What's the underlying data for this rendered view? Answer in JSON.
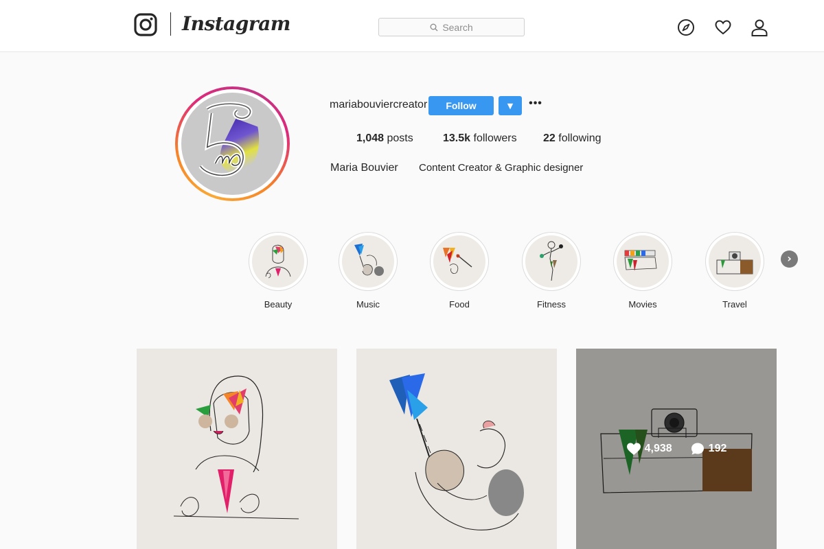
{
  "header": {
    "wordmark": "Instagram",
    "search": {
      "placeholder": "Search"
    },
    "icons": [
      "instagram-logo-icon",
      "compass-icon",
      "heart-icon",
      "person-icon"
    ]
  },
  "profile": {
    "username": "mariabouviercreator",
    "follow_label": "Follow",
    "dropdown_label": "▼",
    "more_label": "•••",
    "stats": [
      {
        "count": "1,048",
        "label": "posts"
      },
      {
        "count": "13.5k",
        "label": "followers"
      },
      {
        "count": "22",
        "label": "following"
      }
    ],
    "full_name": "Maria Bouvier",
    "bio": "Content Creator & Graphic designer"
  },
  "highlights": [
    {
      "label": "Beauty"
    },
    {
      "label": "Music"
    },
    {
      "label": "Food"
    },
    {
      "label": "Fitness"
    },
    {
      "label": "Movies"
    },
    {
      "label": "Travel"
    }
  ],
  "highlights_next": "›",
  "posts": [
    {
      "subject": "woman portrait line art"
    },
    {
      "subject": "guitar player line art"
    },
    {
      "subject": "suitcase and camera line art",
      "likes": "4,938",
      "comments": "192"
    }
  ],
  "colors": {
    "accent": "#3897f0",
    "text": "#262626",
    "muted": "#8e8e8e",
    "background": "#fafafa"
  }
}
